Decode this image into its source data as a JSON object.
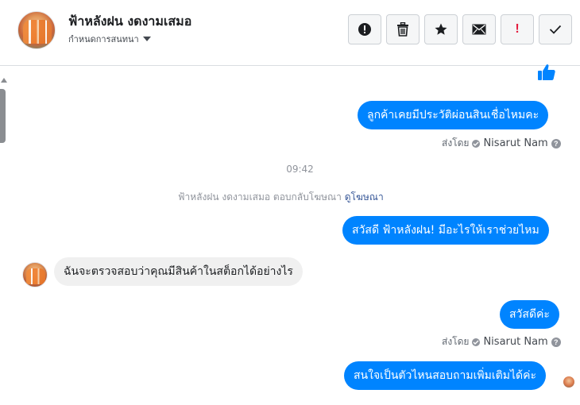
{
  "header": {
    "contact_name": "ฟ้าหลังฝน งดงามเสมอ",
    "assign_label": "กำหนดการสนทนา",
    "actions": [
      {
        "name": "spam-button",
        "icon": "alert-circle-icon"
      },
      {
        "name": "delete-button",
        "icon": "trash-icon"
      },
      {
        "name": "star-button",
        "icon": "star-icon"
      },
      {
        "name": "mail-button",
        "icon": "envelope-icon"
      },
      {
        "name": "important-button",
        "icon": "exclamation-icon",
        "glyph": "!"
      },
      {
        "name": "done-button",
        "icon": "check-icon"
      }
    ]
  },
  "messages": {
    "like": {
      "icon": "thumbs-up-icon",
      "color": "#0084ff"
    },
    "msg1": {
      "text": "ลูกค้าเคยมีประวัติผ่อนสินเชื่อไหมคะ"
    },
    "sent1": {
      "label": "ส่งโดย",
      "agent": "Nisarut Nam"
    },
    "time": "09:42",
    "system": {
      "text": "ฟ้าหลังฝน งดงามเสมอ ตอบกลับโฆษณา",
      "link": "ดูโฆษณา"
    },
    "msg2": {
      "text": "สวัสดี ฟ้าหลังฝน! มีอะไรให้เราช่วยไหม"
    },
    "msg3": {
      "text": "ฉันจะตรวจสอบว่าคุณมีสินค้าในสต็อกได้อย่างไร"
    },
    "msg4": {
      "text": "สวัสดีค่ะ"
    },
    "sent2": {
      "label": "ส่งโดย",
      "agent": "Nisarut Nam"
    },
    "msg5": {
      "text": "สนใจเป็นตัวไหนสอบถามเพิ่มเติมได้ค่ะ"
    }
  },
  "colors": {
    "outgoing_bubble": "#0084ff",
    "incoming_bubble": "#f0f0f0",
    "link": "#385898",
    "danger": "#e41e3f"
  }
}
